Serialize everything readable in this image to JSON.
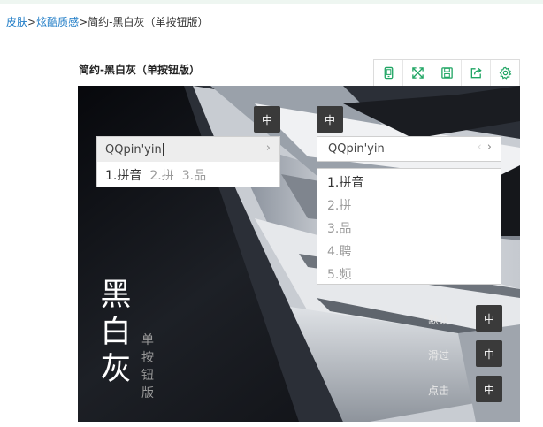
{
  "breadcrumb": {
    "items": [
      "皮肤",
      "炫酷质感",
      "简约-黑白灰（单按钮版）"
    ],
    "separator": ">"
  },
  "card": {
    "title": "简约-黑白灰（单按钮版）",
    "toolbar": [
      "phone-preview-icon",
      "fullscreen-icon",
      "save-icon",
      "share-icon",
      "settings-icon"
    ],
    "accent_color": "#1fa563"
  },
  "preview": {
    "status_buttons": {
      "horizontal": "中",
      "vertical": "中"
    },
    "ime_horizontal": {
      "composition": "QQpin'yin",
      "next_arrow": "›",
      "candidates": [
        "1.拼音",
        "2.拼",
        "3.品"
      ]
    },
    "ime_vertical": {
      "composition": "QQpin'yin",
      "prev_arrow": "‹",
      "next_arrow": "›",
      "candidates": [
        "1.拼音",
        "2.拼",
        "3.品",
        "4.聘",
        "5.频"
      ]
    },
    "skin_name": [
      "黑",
      "白",
      "灰"
    ],
    "skin_variant": [
      "单",
      "按",
      "钮",
      "版"
    ],
    "states": [
      {
        "label": "默认",
        "button": "中"
      },
      {
        "label": "滑过",
        "button": "中"
      },
      {
        "label": "点击",
        "button": "中"
      }
    ]
  }
}
